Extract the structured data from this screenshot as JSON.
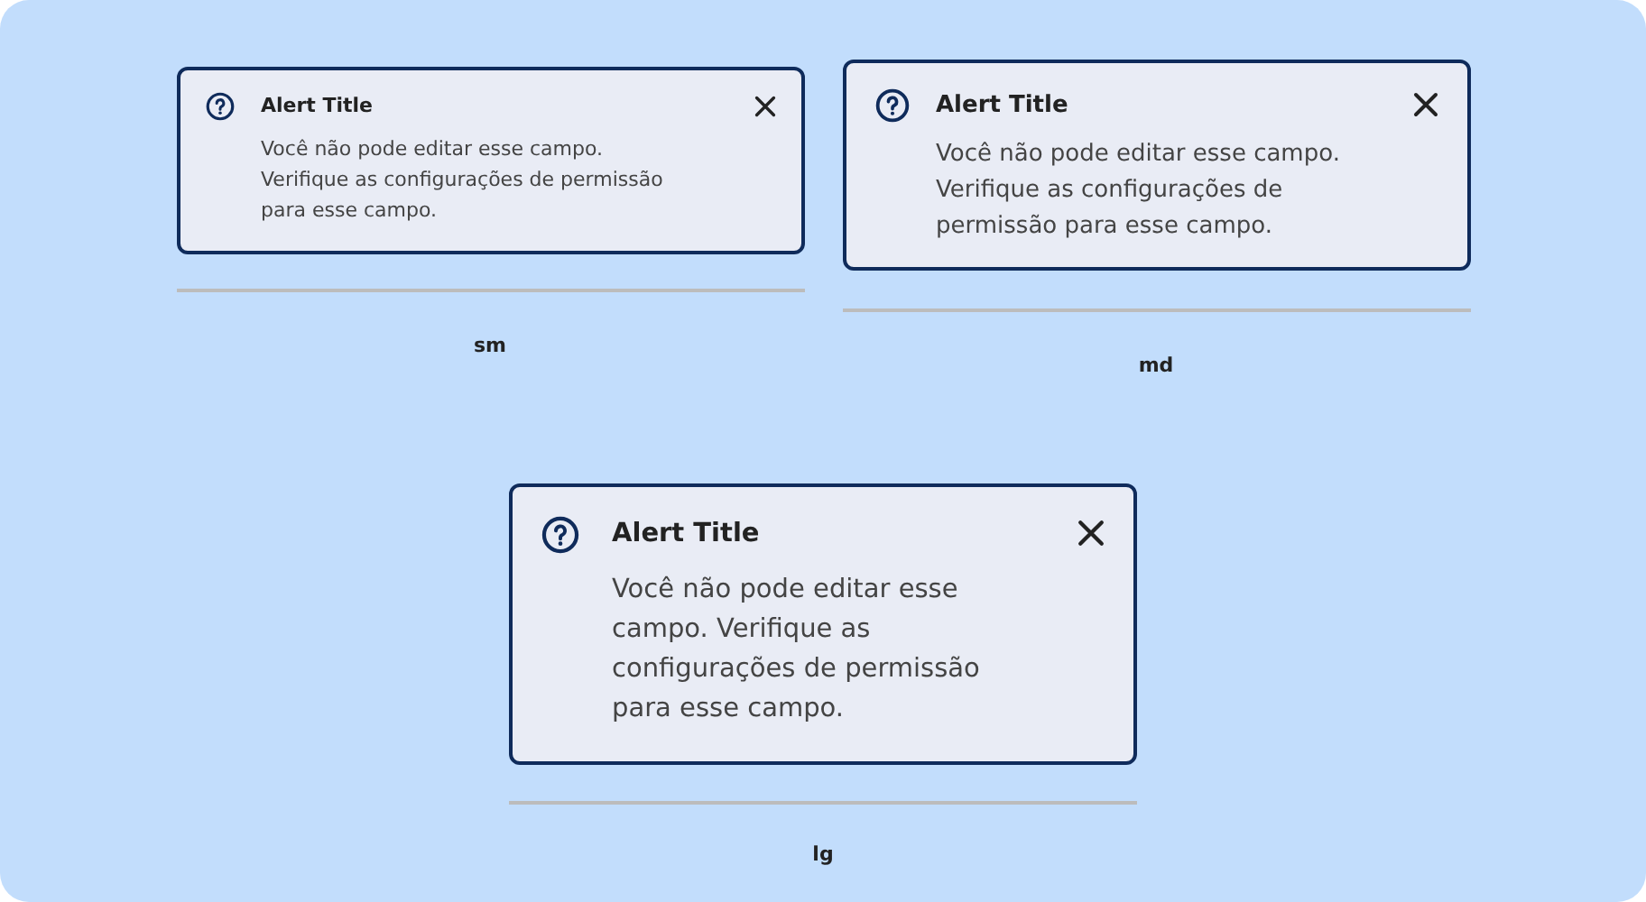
{
  "alerts": [
    {
      "title": "Alert Title",
      "message": "Você não pode editar esse campo. Verifique as configurações de permissão para esse campo.",
      "label": "sm"
    },
    {
      "title": "Alert Title",
      "message": "Você não pode editar esse campo. Verifique as configurações de permissão para esse campo.",
      "label": "md"
    },
    {
      "title": "Alert Title",
      "message": "Você não pode editar esse campo. Verifique as configurações de permissão para esse campo.",
      "label": "lg"
    }
  ]
}
